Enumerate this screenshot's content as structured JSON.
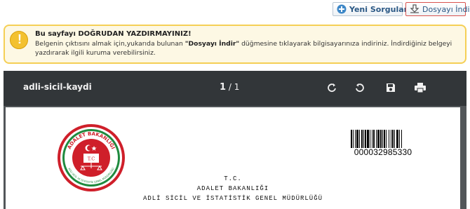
{
  "toolbar": {
    "new_query_label": "Yeni Sorgulama",
    "download_label": "Dosyayı İndir",
    "new_query_icon": "plus-circle-icon",
    "download_icon": "download-icon"
  },
  "warning": {
    "icon": "exclamation-icon",
    "icon_glyph": "!",
    "title": "Bu sayfayı DOĞRUDAN YAZDIRMAYINIZ!",
    "body_part1": "Belgenin çıktısını almak için,yukarıda bulunan ",
    "body_bold": "\"Dosyayı İndir\"",
    "body_part2": " düğmesine tıklayarak bilgisayarınıza indiriniz. İndirdiğiniz belgeyi yazdırarak ilgili kuruma verebilirsiniz."
  },
  "viewer": {
    "document_name": "adli-sicil-kaydi",
    "current_page": "1",
    "page_separator": "/",
    "total_pages": "1",
    "tools": [
      "rotate-clockwise-icon",
      "rotate-counterclockwise-icon",
      "save-icon",
      "print-icon"
    ]
  },
  "document": {
    "seal_text_top": "ADALET BAKANLIĞI",
    "seal_text_bottom": "ADLİ SİCİL VE İSTATİSTİK GENEL MÜDÜRLÜĞÜ",
    "seal_monogram": "T.C",
    "barcode_number": "000032985330",
    "header_line1": "T.C.",
    "header_line2": "ADALET BAKANLIĞI",
    "header_line3": "ADLİ SİCİL VE İSTATİSTİK GENEL MÜDÜRLÜĞÜ"
  },
  "colors": {
    "warning_border": "#f5cf55",
    "warning_bg": "#fdf8e4",
    "viewer_toolbar": "#323639",
    "viewer_bg": "#525659",
    "seal_red": "#cf1f2a",
    "seal_green": "#1f8a3e",
    "link_blue": "#2a5885"
  }
}
